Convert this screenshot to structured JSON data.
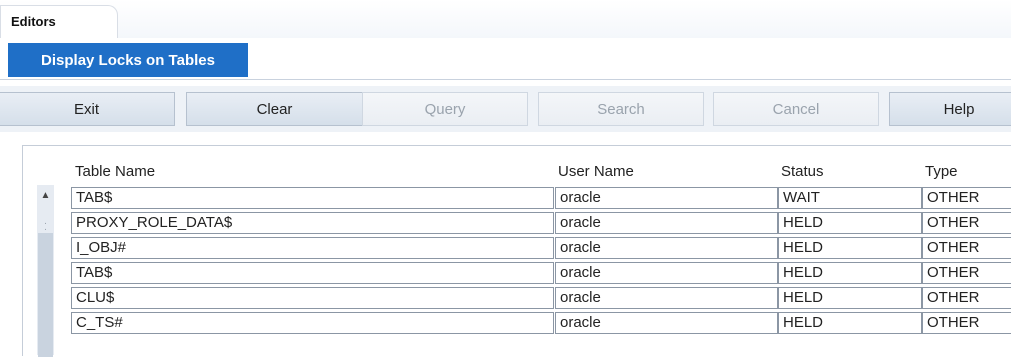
{
  "tabs": {
    "editors": "Editors"
  },
  "subtitle": "Display Locks on Tables",
  "toolbar": {
    "exit": "Exit",
    "clear": "Clear",
    "query": "Query",
    "search": "Search",
    "cancel": "Cancel",
    "help": "Help"
  },
  "grid": {
    "columns": [
      "Table Name",
      "User Name",
      "Status",
      "Type"
    ],
    "rows": [
      [
        "TAB$",
        "oracle",
        "WAIT",
        "OTHER"
      ],
      [
        "PROXY_ROLE_DATA$",
        "oracle",
        "HELD",
        "OTHER"
      ],
      [
        "I_OBJ#",
        "oracle",
        "HELD",
        "OTHER"
      ],
      [
        "TAB$",
        "oracle",
        "HELD",
        "OTHER"
      ],
      [
        "CLU$",
        "oracle",
        "HELD",
        "OTHER"
      ],
      [
        "C_TS#",
        "oracle",
        "HELD",
        "OTHER"
      ]
    ]
  }
}
